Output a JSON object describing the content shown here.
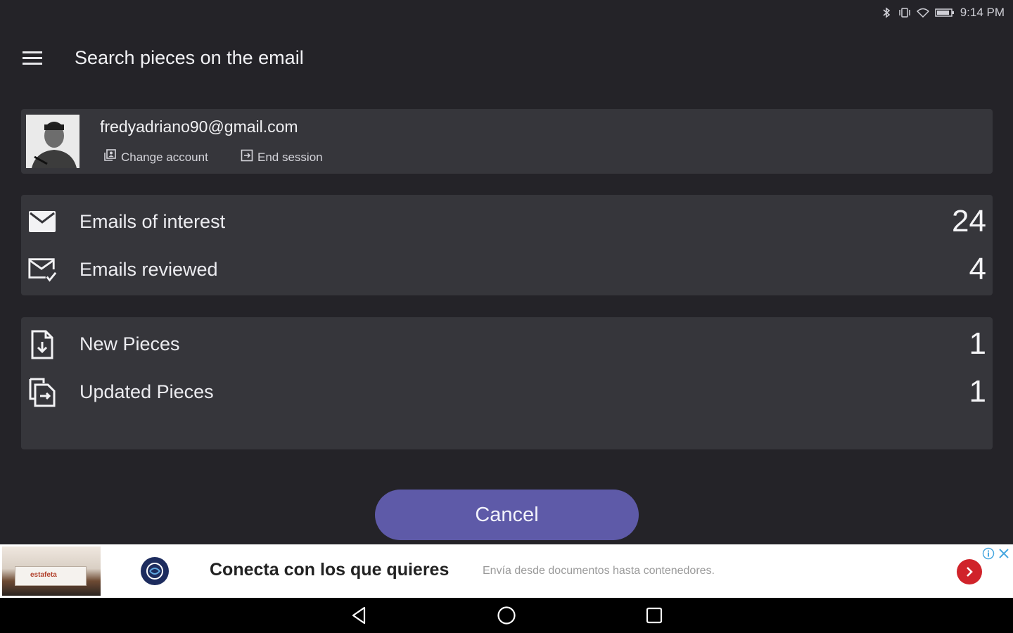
{
  "status_bar": {
    "time": "9:14 PM",
    "icons": [
      "bluetooth-icon",
      "vibrate-icon",
      "wifi-icon",
      "battery-icon"
    ]
  },
  "app_bar": {
    "menu_icon": "hamburger-menu-icon",
    "title": "Search pieces on the email"
  },
  "account": {
    "email": "fredyadriano90@gmail.com",
    "change_account_label": "Change account",
    "end_session_label": "End session",
    "change_account_icon": "account-switch-icon",
    "end_session_icon": "logout-icon"
  },
  "email_stats": [
    {
      "label": "Emails of interest",
      "value": "24",
      "icon": "mail-icon"
    },
    {
      "label": "Emails reviewed",
      "value": "4",
      "icon": "mail-check-icon"
    }
  ],
  "piece_stats": [
    {
      "label": "New Pieces",
      "value": "1",
      "icon": "file-download-icon"
    },
    {
      "label": "Updated Pieces",
      "value": "1",
      "icon": "file-sync-icon"
    }
  ],
  "cancel_button": {
    "label": "Cancel",
    "color": "#5e5aa8"
  },
  "ad": {
    "image_label": "estafeta",
    "title": "Conecta con los que quieres",
    "description": "Envía desde documentos hasta contenedores.",
    "cta_color": "#d0232a"
  },
  "nav_bar": {
    "icons": [
      "back-icon",
      "home-icon",
      "recents-icon"
    ]
  },
  "colors": {
    "background": "#242328",
    "card": "#36363b",
    "accent": "#5e5aa8"
  }
}
